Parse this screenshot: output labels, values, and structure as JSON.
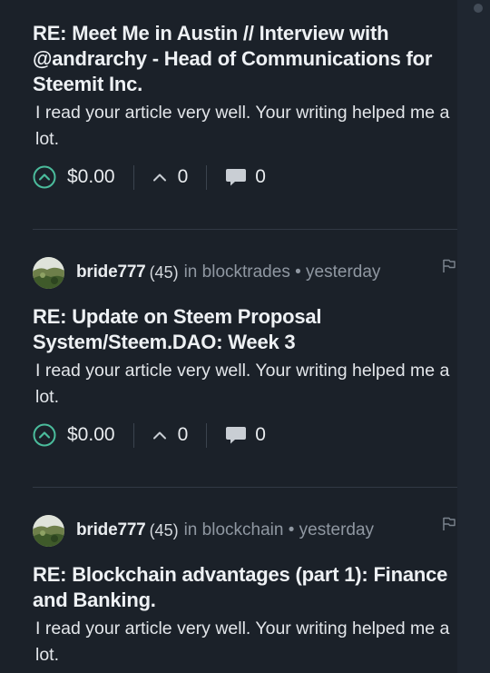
{
  "posts": [
    {
      "title": "RE: Meet Me in Austin // Interview with @andrarchy - Head of Communications for Steemit Inc.",
      "body": "I read your article very well. Your writing helped me a lot.",
      "payout": "$0.00",
      "votes": "0",
      "comments": "0"
    },
    {
      "author": "bride777",
      "reputation": "(45)",
      "in_label": "in",
      "community": "blocktrades",
      "bullet": "•",
      "time": "yesterday",
      "title": "RE: Update on Steem Proposal System/Steem.DAO: Week 3",
      "body": "I read your article very well. Your writing helped me a lot.",
      "payout": "$0.00",
      "votes": "0",
      "comments": "0"
    },
    {
      "author": "bride777",
      "reputation": "(45)",
      "in_label": "in",
      "community": "blockchain",
      "bullet": "•",
      "time": "yesterday",
      "title": "RE: Blockchain advantages (part 1): Finance and Banking.",
      "body": "I read your article very well. Your writing helped me a lot."
    }
  ],
  "colors": {
    "background": "#1b2129",
    "upvote_accent": "#4bbc9c",
    "muted_text": "#8f97a1",
    "divider": "#313944"
  },
  "icons": {
    "upvote": "upvote-circle-icon",
    "vote_count": "caret-up-icon",
    "comments": "comment-bubble-icon",
    "flag": "flag-icon",
    "avatar": "avatar"
  }
}
